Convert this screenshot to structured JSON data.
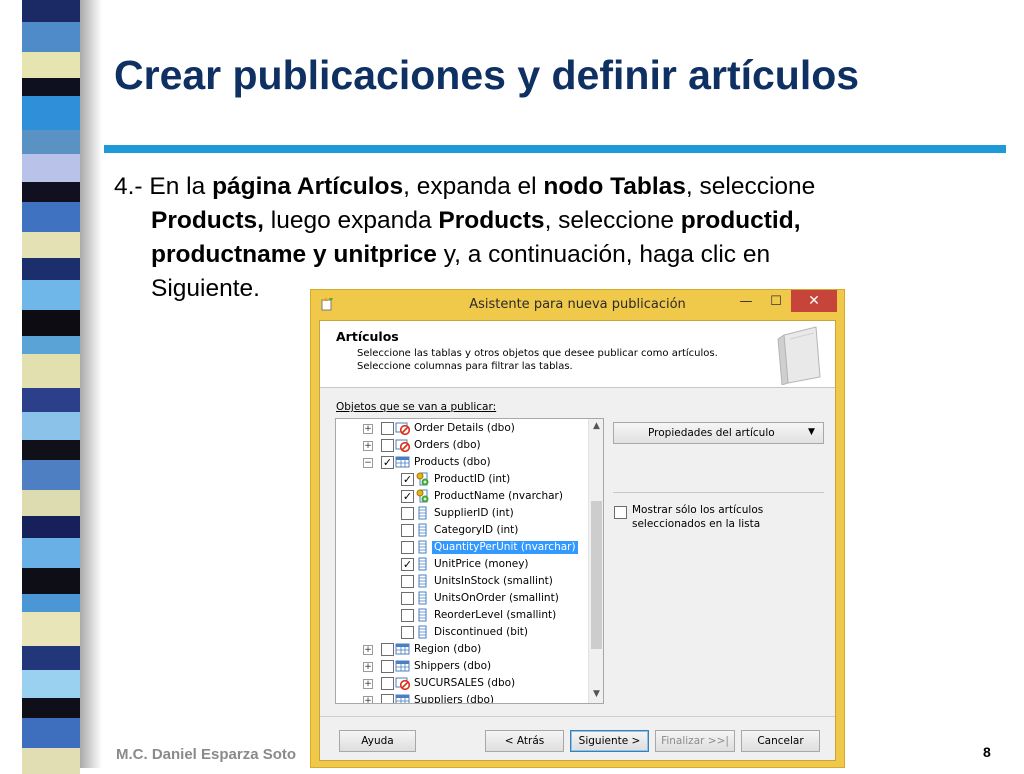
{
  "slide": {
    "title": "Crear publicaciones y definir artículos",
    "instruction": {
      "n": "4.- ",
      "t1": "En la ",
      "b1": "página Artículos",
      "t2": ", expanda el ",
      "b2": "nodo Tablas",
      "t3": ", seleccione",
      "b3": "Products,",
      "t4": " luego expanda ",
      "b4": "Products",
      "t5": ", seleccione ",
      "b5": "productid,",
      "b6": "productname y unitprice",
      "t6": " y, a continuación, haga clic en",
      "t7": "Siguiente."
    },
    "footer_author": "M.C. Daniel Esparza Soto",
    "page_number": "8"
  },
  "dialog": {
    "title": "Asistente para nueva publicación",
    "window_controls": {
      "minimize": "—",
      "maximize": "☐",
      "close": "✕"
    },
    "page_heading": "Artículos",
    "page_desc_1": "Seleccione las tablas y otros objetos que desee publicar como artículos.",
    "page_desc_2": "Seleccione columnas para filtrar las tablas.",
    "objects_label": "Objetos que se van a publicar:",
    "tree_items": [
      {
        "label": "Order Details (dbo)",
        "kind": "table-excluded",
        "checked": false,
        "expander": "+"
      },
      {
        "label": "Orders (dbo)",
        "kind": "table-excluded",
        "checked": false,
        "expander": "+"
      },
      {
        "label": "Products (dbo)",
        "kind": "table",
        "checked": true,
        "expander": "−"
      },
      {
        "label": "ProductID (int)",
        "kind": "key-column",
        "checked": true
      },
      {
        "label": "ProductName (nvarchar)",
        "kind": "key-column",
        "checked": true
      },
      {
        "label": "SupplierID (int)",
        "kind": "column",
        "checked": false
      },
      {
        "label": "CategoryID (int)",
        "kind": "column",
        "checked": false
      },
      {
        "label": "QuantityPerUnit (nvarchar)",
        "kind": "column",
        "checked": false,
        "selected": true
      },
      {
        "label": "UnitPrice (money)",
        "kind": "column",
        "checked": true
      },
      {
        "label": "UnitsInStock (smallint)",
        "kind": "column",
        "checked": false
      },
      {
        "label": "UnitsOnOrder (smallint)",
        "kind": "column",
        "checked": false
      },
      {
        "label": "ReorderLevel (smallint)",
        "kind": "column",
        "checked": false
      },
      {
        "label": "Discontinued (bit)",
        "kind": "column",
        "checked": false
      },
      {
        "label": "Region (dbo)",
        "kind": "table",
        "checked": false,
        "expander": "+"
      },
      {
        "label": "Shippers (dbo)",
        "kind": "table",
        "checked": false,
        "expander": "+"
      },
      {
        "label": "SUCURSALES (dbo)",
        "kind": "table-excluded",
        "checked": false,
        "expander": "+"
      },
      {
        "label": "Suppliers (dbo)",
        "kind": "table",
        "checked": false,
        "expander": "+"
      }
    ],
    "properties_button": "Propiedades del artículo",
    "show_selected_line1": "Mostrar sólo los artículos",
    "show_selected_line2": "seleccionados en la lista",
    "buttons": {
      "help": "Ayuda",
      "back": "< Atrás",
      "next": "Siguiente >",
      "finish": "Finalizar >>|",
      "cancel": "Cancelar"
    }
  },
  "colors": {
    "title_text": "#0f3062",
    "title_rule": "#1f9ad8",
    "dialog_frame": "#f0c94a",
    "selection": "#3399ff",
    "close_button": "#c7443a"
  },
  "icons": [
    "table-icon",
    "excluded-table-icon",
    "column-icon",
    "key-column-icon",
    "wizard-icon",
    "book-icon",
    "dropdown-arrow-icon"
  ]
}
